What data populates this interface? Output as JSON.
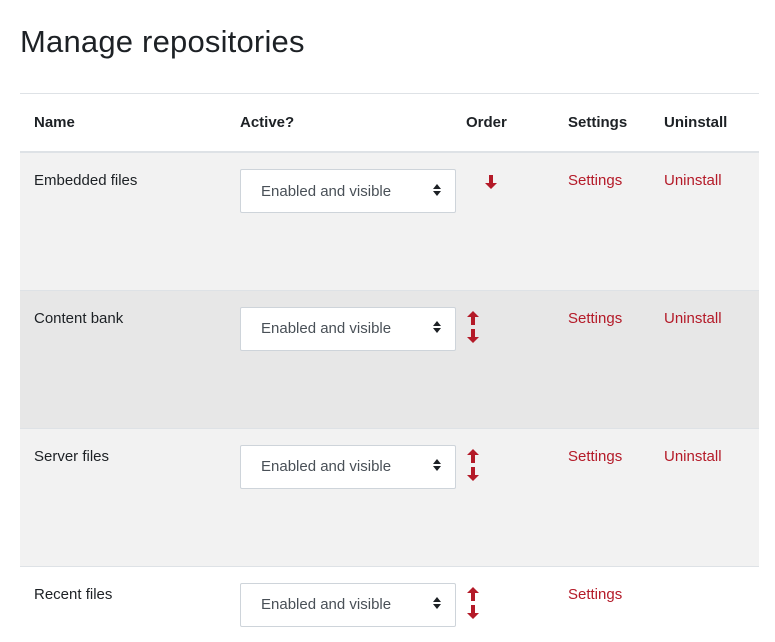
{
  "page": {
    "title": "Manage repositories"
  },
  "table": {
    "headers": {
      "name": "Name",
      "active": "Active?",
      "order": "Order",
      "settings": "Settings",
      "uninstall": "Uninstall"
    },
    "rows": [
      {
        "name": "Embedded files",
        "active": "Enabled and visible",
        "order": [
          "move-down"
        ],
        "settings": "Settings",
        "uninstall": "Uninstall"
      },
      {
        "name": "Content bank",
        "active": "Enabled and visible",
        "order": [
          "move-up",
          "move-down"
        ],
        "settings": "Settings",
        "uninstall": "Uninstall"
      },
      {
        "name": "Server files",
        "active": "Enabled and visible",
        "order": [
          "move-up",
          "move-down"
        ],
        "settings": "Settings",
        "uninstall": "Uninstall"
      },
      {
        "name": "Recent files",
        "active": "Enabled and visible",
        "order": [
          "move-up",
          "move-down"
        ],
        "settings": "Settings",
        "uninstall": ""
      }
    ]
  },
  "colors": {
    "link": "#b41a28",
    "arrow": "#b41a28"
  },
  "icons": {
    "select_caret": "sort-caret-icon",
    "up": "arrow-up-icon",
    "down": "arrow-down-icon"
  }
}
